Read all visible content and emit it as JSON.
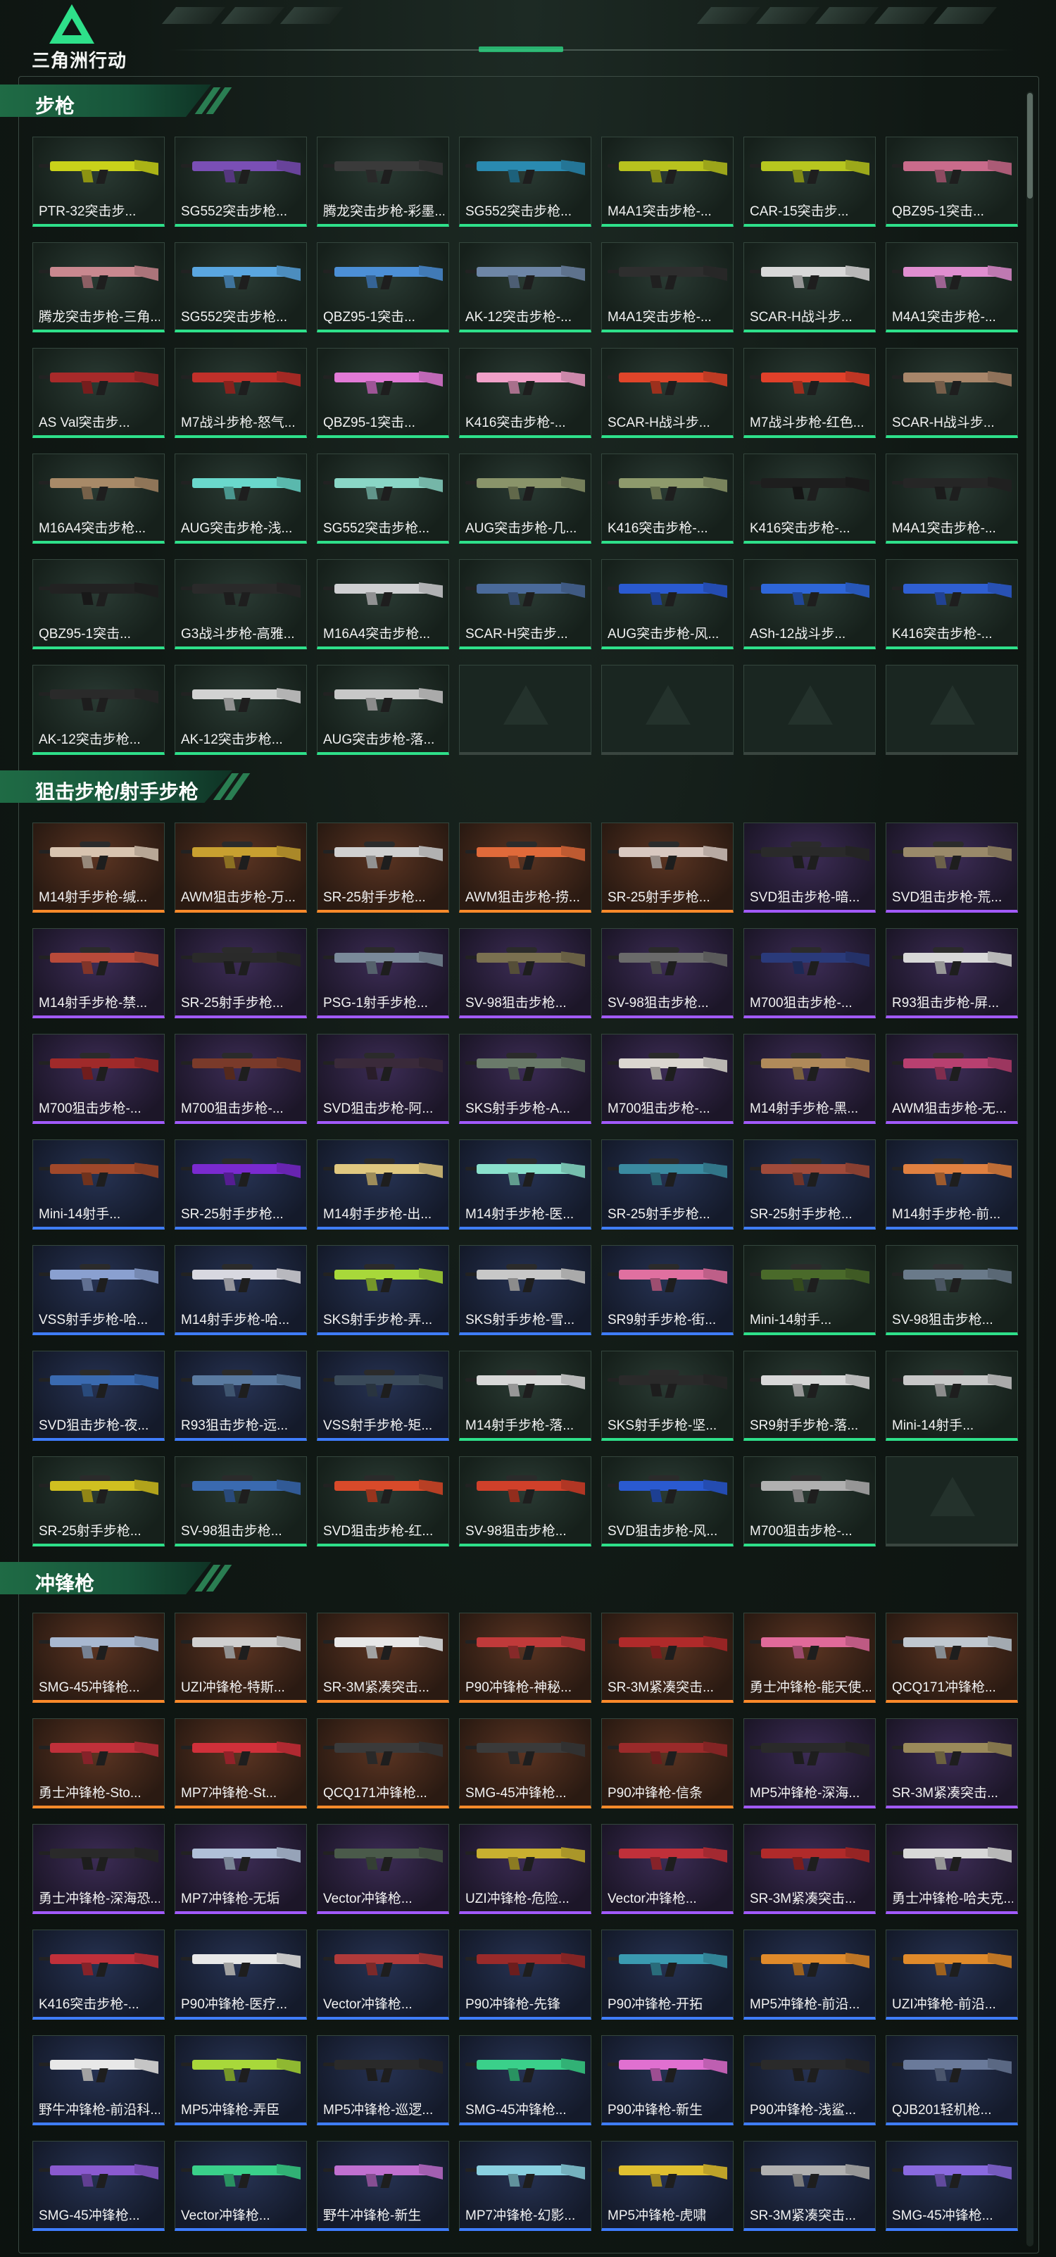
{
  "header": {
    "logo_text": "三角洲行动"
  },
  "colors": {
    "green": "#2ee08a",
    "orange": "#ff8a2a",
    "purple": "#a25aff",
    "blue": "#3f7dff",
    "empty": "#3a4640"
  },
  "sections": [
    {
      "title": "步枪",
      "items": [
        {
          "name": "PTR-32突击步...",
          "rarity": "green",
          "color": "#c9d21a"
        },
        {
          "name": "SG552突击步枪...",
          "rarity": "green",
          "color": "#7a4fb5"
        },
        {
          "name": "腾龙突击步枪-彩墨...",
          "rarity": "green",
          "color": "#3a3a3a"
        },
        {
          "name": "SG552突击步枪...",
          "rarity": "green",
          "color": "#2a8ab0"
        },
        {
          "name": "M4A1突击步枪-...",
          "rarity": "green",
          "color": "#b8c21e"
        },
        {
          "name": "CAR-15突击步...",
          "rarity": "green",
          "color": "#b7c61f"
        },
        {
          "name": "QBZ95-1突击...",
          "rarity": "green",
          "color": "#c96b8b"
        },
        {
          "name": "腾龙突击步枪-三角...",
          "rarity": "green",
          "color": "#c9888f"
        },
        {
          "name": "SG552突击步枪...",
          "rarity": "green",
          "color": "#5aa6e0"
        },
        {
          "name": "QBZ95-1突击...",
          "rarity": "green",
          "color": "#4c8fd6"
        },
        {
          "name": "AK-12突击步枪-...",
          "rarity": "green",
          "color": "#6e86a6"
        },
        {
          "name": "M4A1突击步枪-...",
          "rarity": "green",
          "color": "#2e2e2e"
        },
        {
          "name": "SCAR-H战斗步...",
          "rarity": "green",
          "color": "#d8d8d8"
        },
        {
          "name": "M4A1突击步枪-...",
          "rarity": "green",
          "color": "#e08ed0"
        },
        {
          "name": "AS Val突击步...",
          "rarity": "green",
          "color": "#a82a2a"
        },
        {
          "name": "M7战斗步枪-怒气...",
          "rarity": "green",
          "color": "#c0302a"
        },
        {
          "name": "QBZ95-1突击...",
          "rarity": "green",
          "color": "#e27ad6"
        },
        {
          "name": "K416突击步枪-...",
          "rarity": "green",
          "color": "#f0a0c8"
        },
        {
          "name": "SCAR-H战斗步...",
          "rarity": "green",
          "color": "#e0452a"
        },
        {
          "name": "M7战斗步枪-红色...",
          "rarity": "green",
          "color": "#e0402a"
        },
        {
          "name": "SCAR-H战斗步...",
          "rarity": "green",
          "color": "#a8866a"
        },
        {
          "name": "M16A4突击步枪...",
          "rarity": "green",
          "color": "#a88a68"
        },
        {
          "name": "AUG突击步枪-浅...",
          "rarity": "green",
          "color": "#6ad8cc"
        },
        {
          "name": "SG552突击步枪...",
          "rarity": "green",
          "color": "#8ad6c6"
        },
        {
          "name": "AUG突击步枪-几...",
          "rarity": "green",
          "color": "#8a946a"
        },
        {
          "name": "K416突击步枪-...",
          "rarity": "green",
          "color": "#8e9a6c"
        },
        {
          "name": "K416突击步枪-...",
          "rarity": "green",
          "color": "#1e1e1e"
        },
        {
          "name": "M4A1突击步枪-...",
          "rarity": "green",
          "color": "#262626"
        },
        {
          "name": "QBZ95-1突击...",
          "rarity": "green",
          "color": "#222222"
        },
        {
          "name": "G3战斗步枪-高雅...",
          "rarity": "green",
          "color": "#2a2a2a"
        },
        {
          "name": "M16A4突击步枪...",
          "rarity": "green",
          "color": "#cfd0d2"
        },
        {
          "name": "SCAR-H突击步...",
          "rarity": "green",
          "color": "#4a6a9a"
        },
        {
          "name": "AUG突击步枪-风...",
          "rarity": "green",
          "color": "#2a5ad0"
        },
        {
          "name": "ASh-12战斗步...",
          "rarity": "green",
          "color": "#2e66d8"
        },
        {
          "name": "K416突击步枪-...",
          "rarity": "green",
          "color": "#2f5fd2"
        },
        {
          "name": "AK-12突击步枪...",
          "rarity": "green",
          "color": "#2a2a2a"
        },
        {
          "name": "AK-12突击步枪...",
          "rarity": "green",
          "color": "#d2d2d2"
        },
        {
          "name": "AUG突击步枪-落...",
          "rarity": "green",
          "color": "#c8c8c8"
        },
        {
          "name": "",
          "rarity": "empty",
          "color": ""
        },
        {
          "name": "",
          "rarity": "empty",
          "color": ""
        },
        {
          "name": "",
          "rarity": "empty",
          "color": ""
        },
        {
          "name": "",
          "rarity": "empty",
          "color": ""
        }
      ]
    },
    {
      "title": "狙击步枪/射手步枪",
      "items": [
        {
          "name": "M14射手步枪-缄...",
          "rarity": "orange",
          "color": "#d8c4b0"
        },
        {
          "name": "AWM狙击步枪-万...",
          "rarity": "orange",
          "color": "#c8a030"
        },
        {
          "name": "SR-25射手步枪...",
          "rarity": "orange",
          "color": "#d0d0d0"
        },
        {
          "name": "AWM狙击步枪-捞...",
          "rarity": "orange",
          "color": "#e06a3a"
        },
        {
          "name": "SR-25射手步枪...",
          "rarity": "orange",
          "color": "#d8c8c0"
        },
        {
          "name": "SVD狙击步枪-暗...",
          "rarity": "purple",
          "color": "#2a2a2a"
        },
        {
          "name": "SVD狙击步枪-荒...",
          "rarity": "purple",
          "color": "#9a8a6a"
        },
        {
          "name": "M14射手步枪-禁...",
          "rarity": "purple",
          "color": "#b84a3a"
        },
        {
          "name": "SR-25射手步枪...",
          "rarity": "purple",
          "color": "#2a2a2a"
        },
        {
          "name": "PSG-1射手步枪...",
          "rarity": "purple",
          "color": "#7a8a9a"
        },
        {
          "name": "SV-98狙击步枪...",
          "rarity": "purple",
          "color": "#7a7050"
        },
        {
          "name": "SV-98狙击步枪...",
          "rarity": "purple",
          "color": "#6a6a6a"
        },
        {
          "name": "M700狙击步枪-...",
          "rarity": "purple",
          "color": "#2a3a7a"
        },
        {
          "name": "R93狙击步枪-屏...",
          "rarity": "purple",
          "color": "#d8d8d8"
        },
        {
          "name": "M700狙击步枪-...",
          "rarity": "purple",
          "color": "#a02a2a"
        },
        {
          "name": "M700狙击步枪-...",
          "rarity": "purple",
          "color": "#7a3a2a"
        },
        {
          "name": "SVD狙击步枪-阿...",
          "rarity": "purple",
          "color": "#3a2a3a"
        },
        {
          "name": "SKS射手步枪-A...",
          "rarity": "purple",
          "color": "#6a7a6a"
        },
        {
          "name": "M700狙击步枪-...",
          "rarity": "purple",
          "color": "#dad6d0"
        },
        {
          "name": "M14射手步枪-黑...",
          "rarity": "purple",
          "color": "#b08a5a"
        },
        {
          "name": "AWM狙击步枪-无...",
          "rarity": "purple",
          "color": "#b84070"
        },
        {
          "name": "Mini-14射手...",
          "rarity": "blue",
          "color": "#a0482a"
        },
        {
          "name": "SR-25射手步枪...",
          "rarity": "blue",
          "color": "#7a2ad0"
        },
        {
          "name": "M14射手步枪-出...",
          "rarity": "blue",
          "color": "#e0c880"
        },
        {
          "name": "M14射手步枪-医...",
          "rarity": "blue",
          "color": "#8ae0cc"
        },
        {
          "name": "SR-25射手步枪...",
          "rarity": "blue",
          "color": "#3a8aa0"
        },
        {
          "name": "SR-25射手步枪...",
          "rarity": "blue",
          "color": "#a04a3a"
        },
        {
          "name": "M14射手步枪-前...",
          "rarity": "blue",
          "color": "#e08040"
        },
        {
          "name": "VSS射手步枪-哈...",
          "rarity": "blue",
          "color": "#8aa0d0"
        },
        {
          "name": "M14射手步枪-哈...",
          "rarity": "blue",
          "color": "#d8d8e0"
        },
        {
          "name": "SKS射手步枪-弄...",
          "rarity": "blue",
          "color": "#a8d83a"
        },
        {
          "name": "SKS射手步枪-雪...",
          "rarity": "blue",
          "color": "#c8c8c8"
        },
        {
          "name": "SR9射手步枪-街...",
          "rarity": "blue",
          "color": "#e070a0"
        },
        {
          "name": "Mini-14射手...",
          "rarity": "green",
          "color": "#4a6a2a"
        },
        {
          "name": "SV-98狙击步枪...",
          "rarity": "green",
          "color": "#6a7a8a"
        },
        {
          "name": "SVD狙击步枪-夜...",
          "rarity": "blue",
          "color": "#3a6ab0"
        },
        {
          "name": "R93狙击步枪-远...",
          "rarity": "blue",
          "color": "#5a7aa0"
        },
        {
          "name": "VSS射手步枪-矩...",
          "rarity": "blue",
          "color": "#3a4a5a"
        },
        {
          "name": "M14射手步枪-落...",
          "rarity": "green",
          "color": "#d8d8d8"
        },
        {
          "name": "SKS射手步枪-坚...",
          "rarity": "green",
          "color": "#2a2a2a"
        },
        {
          "name": "SR9射手步枪-落...",
          "rarity": "green",
          "color": "#d8d8d8"
        },
        {
          "name": "Mini-14射手...",
          "rarity": "green",
          "color": "#c8c8c8"
        },
        {
          "name": "SR-25射手步枪...",
          "rarity": "green",
          "color": "#d0c020"
        },
        {
          "name": "SV-98狙击步枪...",
          "rarity": "green",
          "color": "#3a6ab0"
        },
        {
          "name": "SVD狙击步枪-红...",
          "rarity": "green",
          "color": "#d84a2a"
        },
        {
          "name": "SV-98狙击步枪...",
          "rarity": "green",
          "color": "#d0402a"
        },
        {
          "name": "SVD狙击步枪-风...",
          "rarity": "green",
          "color": "#2a5ad0"
        },
        {
          "name": "M700狙击步枪-...",
          "rarity": "green",
          "color": "#b0b0b0"
        },
        {
          "name": "",
          "rarity": "empty",
          "color": ""
        }
      ]
    },
    {
      "title": "冲锋枪",
      "items": [
        {
          "name": "SMG-45冲锋枪...",
          "rarity": "orange",
          "color": "#a8b8d0"
        },
        {
          "name": "UZI冲锋枪-特斯...",
          "rarity": "orange",
          "color": "#d0d0d0"
        },
        {
          "name": "SR-3M紧凑突击...",
          "rarity": "orange",
          "color": "#e8e8e8"
        },
        {
          "name": "P90冲锋枪-神秘...",
          "rarity": "orange",
          "color": "#c03a3a"
        },
        {
          "name": "SR-3M紧凑突击...",
          "rarity": "orange",
          "color": "#b02a2a"
        },
        {
          "name": "勇士冲锋枪-能天使...",
          "rarity": "orange",
          "color": "#e06a9a"
        },
        {
          "name": "QCQ171冲锋枪...",
          "rarity": "orange",
          "color": "#c0c8d0"
        },
        {
          "name": "勇士冲锋枪-Sto...",
          "rarity": "orange",
          "color": "#c0303a"
        },
        {
          "name": "MP7冲锋枪-St...",
          "rarity": "orange",
          "color": "#d0303a"
        },
        {
          "name": "QCQ171冲锋枪...",
          "rarity": "orange",
          "color": "#3a3a3a"
        },
        {
          "name": "SMG-45冲锋枪...",
          "rarity": "orange",
          "color": "#3a3a3a"
        },
        {
          "name": "P90冲锋枪-信条",
          "rarity": "orange",
          "color": "#9a2a2a"
        },
        {
          "name": "MP5冲锋枪-深海...",
          "rarity": "purple",
          "color": "#2a2a2a"
        },
        {
          "name": "SR-3M紧凑突击...",
          "rarity": "purple",
          "color": "#9a8a5a"
        },
        {
          "name": "勇士冲锋枪-深海恐...",
          "rarity": "purple",
          "color": "#2a2a2a"
        },
        {
          "name": "MP7冲锋枪-无垢",
          "rarity": "purple",
          "color": "#b0c0d8"
        },
        {
          "name": "Vector冲锋枪...",
          "rarity": "purple",
          "color": "#4a5a4a"
        },
        {
          "name": "UZI冲锋枪-危险...",
          "rarity": "purple",
          "color": "#c8b030"
        },
        {
          "name": "Vector冲锋枪...",
          "rarity": "purple",
          "color": "#c0303a"
        },
        {
          "name": "SR-3M紧凑突击...",
          "rarity": "purple",
          "color": "#b02a2a"
        },
        {
          "name": "勇士冲锋枪-哈夫克...",
          "rarity": "purple",
          "color": "#d8d8d8"
        },
        {
          "name": "K416突击步枪-...",
          "rarity": "blue",
          "color": "#c0303a"
        },
        {
          "name": "P90冲锋枪-医疗...",
          "rarity": "blue",
          "color": "#e8e8e8"
        },
        {
          "name": "Vector冲锋枪...",
          "rarity": "blue",
          "color": "#b03a3a"
        },
        {
          "name": "P90冲锋枪-先锋",
          "rarity": "blue",
          "color": "#9a2a2a"
        },
        {
          "name": "P90冲锋枪-开拓",
          "rarity": "blue",
          "color": "#3a9ab0"
        },
        {
          "name": "MP5冲锋枪-前沿...",
          "rarity": "blue",
          "color": "#e08a2a"
        },
        {
          "name": "UZI冲锋枪-前沿...",
          "rarity": "blue",
          "color": "#e08a2a"
        },
        {
          "name": "野牛冲锋枪-前沿科...",
          "rarity": "blue",
          "color": "#e8e8e8"
        },
        {
          "name": "MP5冲锋枪-弄臣",
          "rarity": "blue",
          "color": "#a8d83a"
        },
        {
          "name": "MP5冲锋枪-巡逻...",
          "rarity": "blue",
          "color": "#2a2a2a"
        },
        {
          "name": "SMG-45冲锋枪...",
          "rarity": "blue",
          "color": "#3ad08a"
        },
        {
          "name": "P90冲锋枪-新生",
          "rarity": "blue",
          "color": "#e070d0"
        },
        {
          "name": "P90冲锋枪-浅鲨...",
          "rarity": "blue",
          "color": "#2a2a2a"
        },
        {
          "name": "QJB201轻机枪...",
          "rarity": "blue",
          "color": "#6a7a9a"
        },
        {
          "name": "SMG-45冲锋枪...",
          "rarity": "blue",
          "color": "#8a5ad0"
        },
        {
          "name": "Vector冲锋枪...",
          "rarity": "blue",
          "color": "#3ad08a"
        },
        {
          "name": "野牛冲锋枪-新生",
          "rarity": "blue",
          "color": "#c070d0"
        },
        {
          "name": "MP7冲锋枪-幻影...",
          "rarity": "blue",
          "color": "#8ad0e0"
        },
        {
          "name": "MP5冲锋枪-虎啸",
          "rarity": "blue",
          "color": "#e0c030"
        },
        {
          "name": "SR-3M紧凑突击...",
          "rarity": "blue",
          "color": "#b0b0b0"
        },
        {
          "name": "SMG-45冲锋枪...",
          "rarity": "blue",
          "color": "#8a6ae0"
        }
      ]
    }
  ]
}
